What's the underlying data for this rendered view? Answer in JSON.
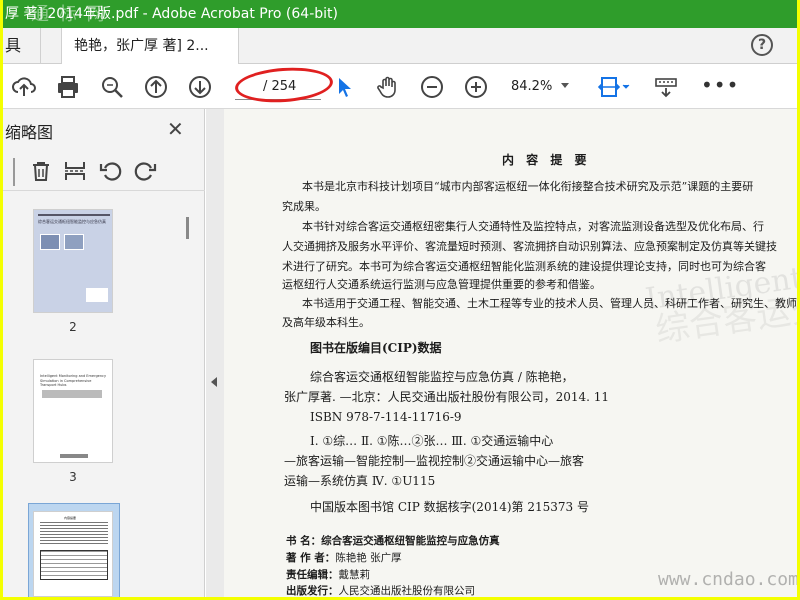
{
  "window": {
    "title": "厚 著] 2014年版.pdf - Adobe Acrobat Pro (64-bit)",
    "watermark": "通 标 网"
  },
  "tabs": {
    "tools_label": "具",
    "doc_tab_label": "艳艳，张广厚 著] 2..."
  },
  "toolbar": {
    "page_of": "/ 254",
    "zoom": "84.2%",
    "icons": [
      "upload-icon",
      "print-icon",
      "zoom-search-icon",
      "page-up-icon",
      "page-down-icon",
      "select-pointer-icon",
      "hand-icon",
      "zoom-out-icon",
      "zoom-in-icon",
      "fit-width-icon",
      "toolbar-more-icon",
      "more-icon"
    ]
  },
  "thumbnails": {
    "title": "缩略图",
    "close": "✕",
    "pages": [
      {
        "label": "2",
        "cover_title": "综合客运交通枢纽智能监控与应急仿真"
      },
      {
        "label": "3",
        "cover_title": "Intelligent Monitoring and Emergency Simulation in Comprehensive Transport Hubs"
      },
      {
        "label": "",
        "cover_title": "内容提要"
      }
    ]
  },
  "document": {
    "summary_title": "内 容 提 要",
    "paragraphs": [
      "本书是北京市科技计划项目“城市内部客运枢纽一体化衔接整合技术研究及示范”课题的主要研",
      "究成果。",
      "本书针对综合客运交通枢纽密集行人交通特性及监控特点，对客流监测设备选型及优化布局、行",
      "人交通拥挤及服务水平评价、客流量短时预测、客流拥挤自动识别算法、应急预案制定及仿真等关键技",
      "术进行了研究。本书可为综合客运交通枢纽智能化监测系统的建设提供理论支持，同时也可为综合客",
      "运枢纽行人交通系统运行监测与应急管理提供重要的参考和借鉴。",
      "本书适用于交通工程、智能交通、土木工程等专业的技术人员、管理人员、科研工作者、研究生、教师",
      "及高年级本科生。"
    ],
    "cip_title": "图书在版编目(CIP)数据",
    "cip_lines": [
      "综合客运交通枢纽智能监控与应急仿真 / 陈艳艳，",
      "张广厚著. —北京：人民交通出版社股份有限公司，2014. 11",
      "ISBN 978-7-114-11716-9",
      "Ⅰ. ①综…  Ⅱ. ①陈…②张…  Ⅲ. ①交通运输中心",
      "—旅客运输—智能控制—监视控制②交通运输中心—旅客",
      "运输—系统仿真  Ⅳ. ①U115",
      "中国版本图书馆 CIP 数据核字(2014)第 215373 号"
    ],
    "credits": [
      {
        "k": "书        名：",
        "v": "综合客运交通枢纽智能监控与应急仿真"
      },
      {
        "k": "著  作  者：",
        "v": "陈艳艳    张广厚"
      },
      {
        "k": "责任编辑：",
        "v": "戴慧莉"
      },
      {
        "k": "出版发行：",
        "v": "人民交通出版社股份有限公司"
      }
    ],
    "ghost_text_1": "Intelligent Monitoring",
    "ghost_text_2": "综合客运交通枢纽",
    "watermark_bottom": "www.cndao.com"
  }
}
